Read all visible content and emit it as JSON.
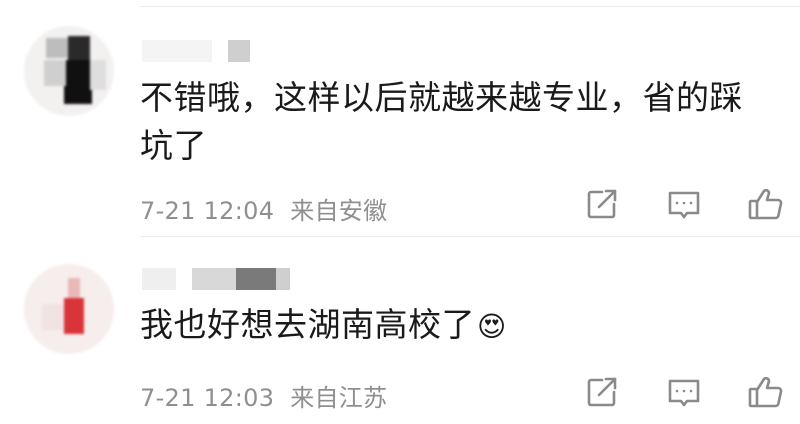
{
  "comments": [
    {
      "text": "不错哦，这样以后就越来越专业，省的踩坑了",
      "time": "7-21 12:04",
      "location": "来自安徽"
    },
    {
      "text": "我也好想去湖南高校了",
      "emoji": "😍",
      "time": "7-21 12:03",
      "location": "来自江苏"
    }
  ],
  "icons": {
    "share": "share-icon",
    "comment": "comment-icon",
    "like": "thumbs-up-icon"
  },
  "colors": {
    "text": "#1a1a1a",
    "meta": "#8f8f8f",
    "icon": "#8a8a8a"
  }
}
